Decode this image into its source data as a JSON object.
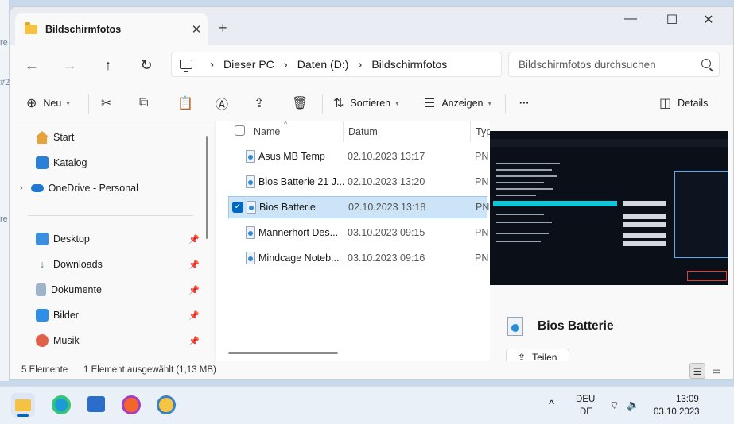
{
  "window": {
    "tab_title": "Bildschirmfotos",
    "tab_close": "✕",
    "new_tab": "+",
    "controls": {
      "minimize": "—",
      "maximize": "☐",
      "close": "✕"
    }
  },
  "nav": {
    "back": "←",
    "forward": "→",
    "up": "↑",
    "refresh": "↻"
  },
  "breadcrumb": [
    "Dieser PC",
    "Daten (D:)",
    "Bildschirmfotos"
  ],
  "breadcrumb_sep": "›",
  "search": {
    "placeholder": "Bildschirmfotos durchsuchen"
  },
  "toolbar": {
    "new_label": "Neu",
    "sort_label": "Sortieren",
    "view_label": "Anzeigen",
    "more_label": "···",
    "details_label": "Details"
  },
  "sidebar": {
    "top": [
      {
        "label": "Start",
        "icon": "home-icon"
      },
      {
        "label": "Katalog",
        "icon": "gallery-icon"
      },
      {
        "label": "OneDrive - Personal",
        "icon": "cloud-icon"
      }
    ],
    "pinned": [
      {
        "label": "Desktop",
        "icon": "desktop-icon"
      },
      {
        "label": "Downloads",
        "icon": "download-icon"
      },
      {
        "label": "Dokumente",
        "icon": "document-icon"
      },
      {
        "label": "Bilder",
        "icon": "pictures-icon"
      },
      {
        "label": "Musik",
        "icon": "music-icon"
      }
    ]
  },
  "filelist": {
    "columns": {
      "name": "Name",
      "date": "Datum",
      "type": "Typ"
    },
    "rows": [
      {
        "name": "Asus MB Temp",
        "date": "02.10.2023 13:17",
        "type": "PN",
        "selected": false
      },
      {
        "name": "Bios Batterie  21 J...",
        "date": "02.10.2023 13:20",
        "type": "PN",
        "selected": false
      },
      {
        "name": "Bios Batterie",
        "date": "02.10.2023 13:18",
        "type": "PN",
        "selected": true
      },
      {
        "name": "Männerhort Des...",
        "date": "03.10.2023 09:15",
        "type": "PN",
        "selected": false
      },
      {
        "name": "Mindcage Noteb...",
        "date": "03.10.2023 09:16",
        "type": "PN",
        "selected": false
      }
    ]
  },
  "preview": {
    "file_name": "Bios Batterie",
    "share_label": "Teilen"
  },
  "status": {
    "count": "5 Elemente",
    "selection": "1 Element ausgewählt (1,13 MB)"
  },
  "taskbar": {
    "lang_line1": "DEU",
    "lang_line2": "DE",
    "time": "13:09",
    "date": "03.10.2023",
    "chevron": "^"
  },
  "colors": {
    "accent": "#0067c0",
    "selection_bg": "#cce4f7",
    "folder": "#f5c244"
  }
}
